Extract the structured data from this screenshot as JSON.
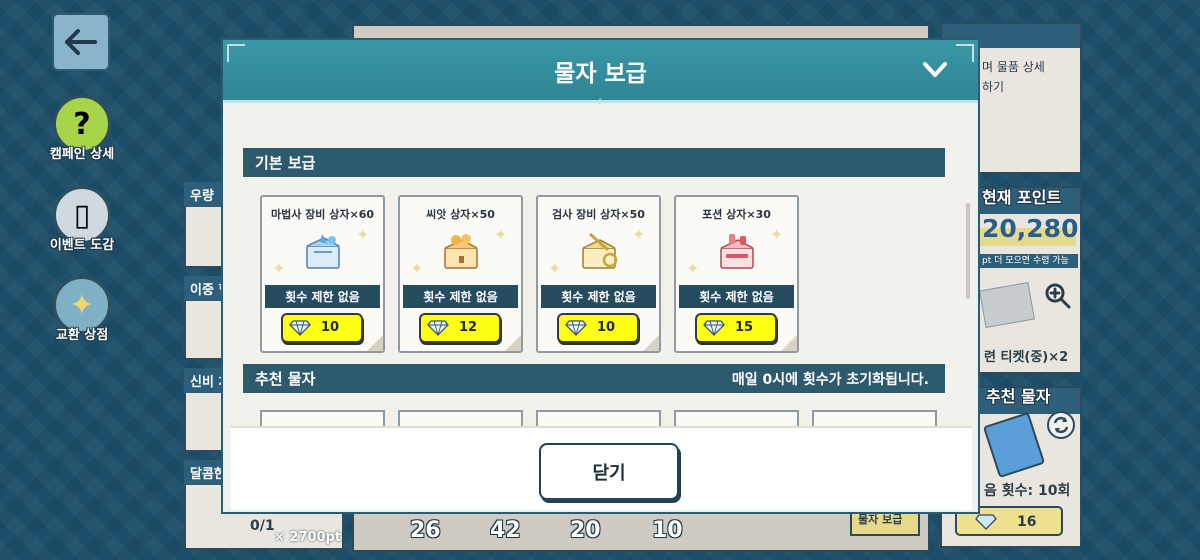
{
  "background": {
    "side_buttons": [
      {
        "label": "캠페인 상세",
        "glyph": "?"
      },
      {
        "label": "이벤트 도감",
        "glyph": "▯"
      },
      {
        "label": "교환 상점",
        "glyph": "✦"
      }
    ],
    "left_tabs": [
      "우량",
      "이중 협",
      "신비 차",
      "달콤한"
    ],
    "bottom_left": {
      "count": "0/1",
      "cost": "× 2700pt"
    },
    "bottom_counts": [
      "26",
      "42",
      "20",
      "10"
    ],
    "right_panel": {
      "top_text_1": "며 물품 상세",
      "top_text_2": "하기",
      "current_points_label": "현재 포인트",
      "points": "20,280",
      "points_note": "pt 더 모으면 수령 가능",
      "ticket_label": "련 티켓(중)×2",
      "recommend_label": "추천 물자",
      "refresh_count": "음 횟수: 10회",
      "refresh_cost": "16",
      "bottom_button": "물자 보급"
    }
  },
  "modal": {
    "title": "물자 보급",
    "section_basic": "기본 보급",
    "section_recommended": "추천 물자",
    "reset_notice": "매일 0시에 횟수가 초기화됩니다.",
    "close_label": "닫기",
    "items": [
      {
        "name": "마법사 장비 상자×60",
        "limit": "횟수 제한 없음",
        "price": "10",
        "icon": "wizard-equipment-box-icon",
        "color": "#5aa9e6"
      },
      {
        "name": "씨앗 상자×50",
        "limit": "횟수 제한 없음",
        "price": "12",
        "icon": "seed-box-icon",
        "color": "#f0b44a"
      },
      {
        "name": "검사 장비 상자×50",
        "limit": "횟수 제한 없음",
        "price": "10",
        "icon": "swordsman-equipment-box-icon",
        "color": "#e8c66a"
      },
      {
        "name": "포션 상자×30",
        "limit": "횟수 제한 없음",
        "price": "15",
        "icon": "potion-box-icon",
        "color": "#e87e86"
      }
    ]
  },
  "colors": {
    "header": "#3493a2",
    "section": "#2e5a6e",
    "price_bg": "#ffff14"
  }
}
